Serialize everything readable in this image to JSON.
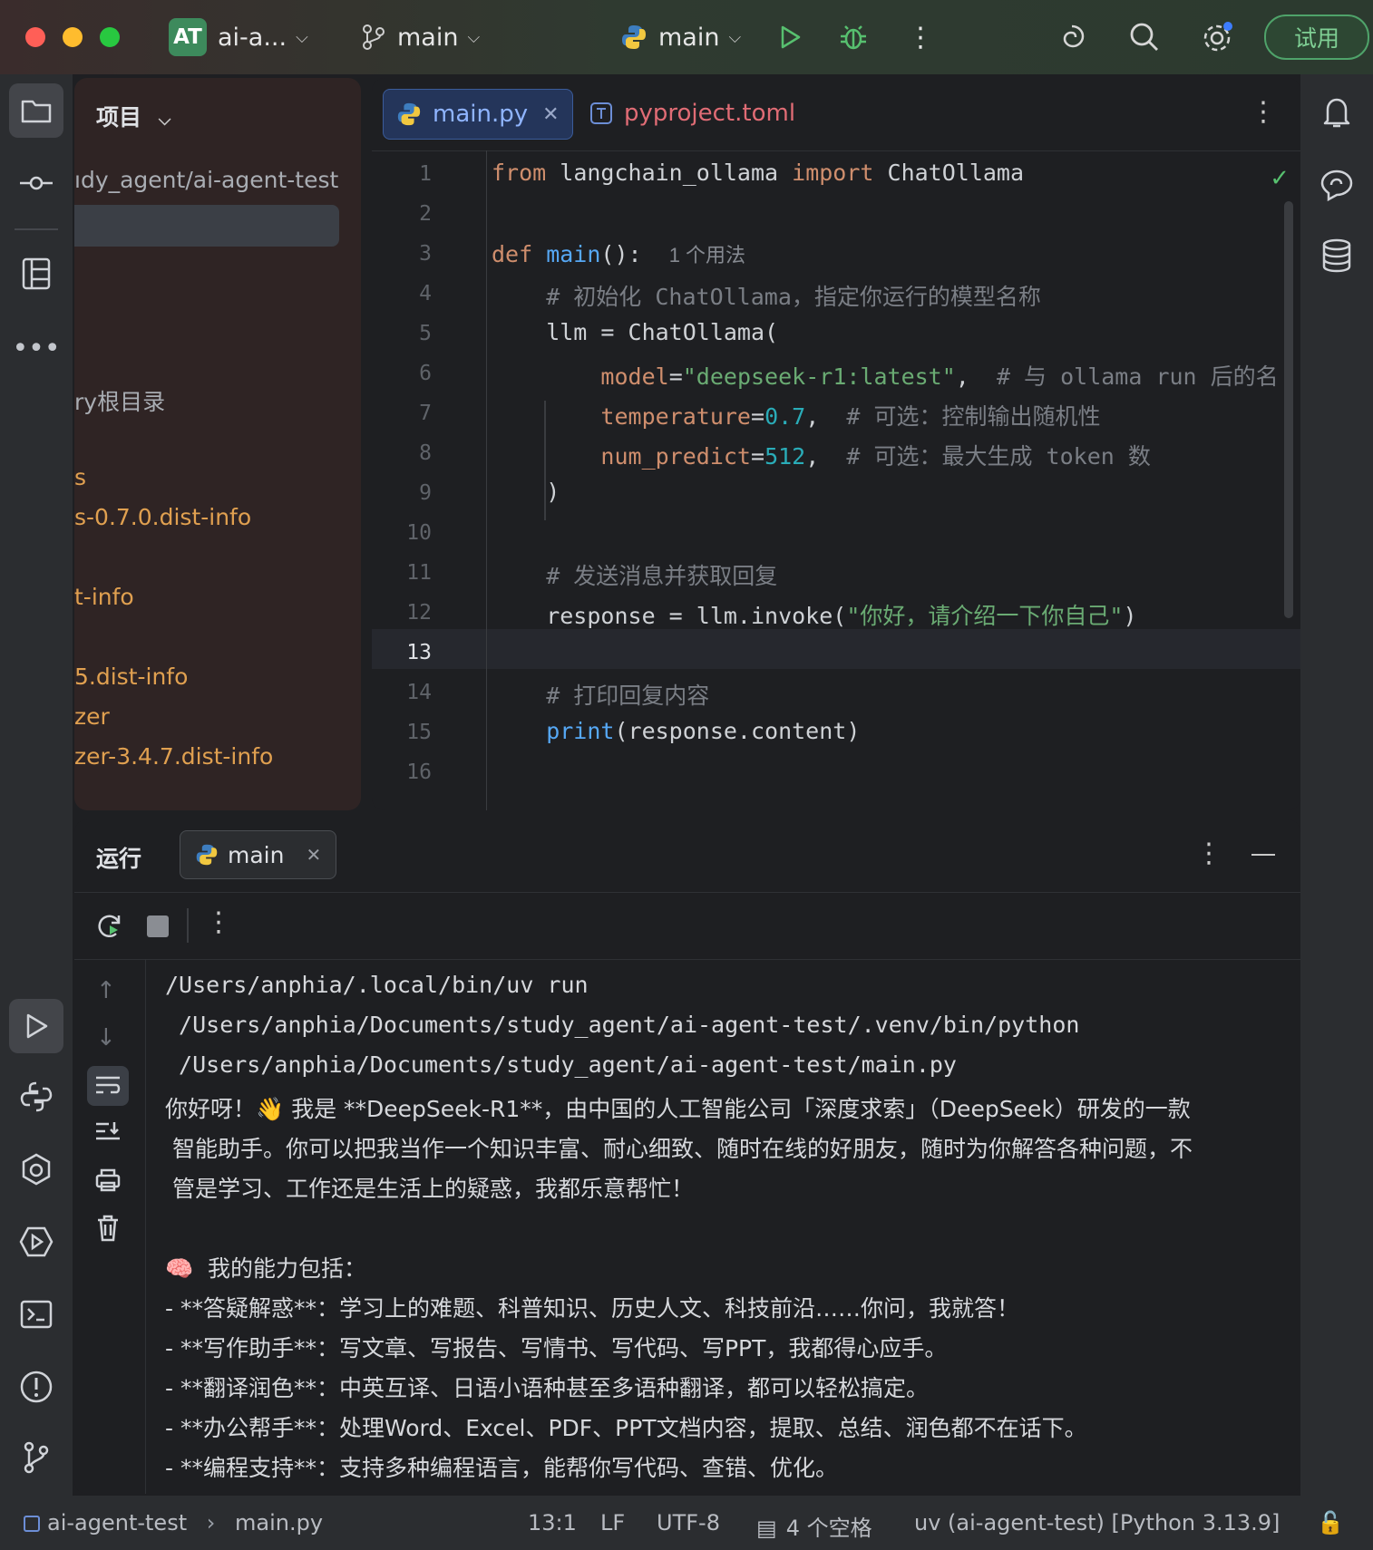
{
  "titlebar": {
    "project_badge": "AT",
    "project_name": "ai-a...",
    "vcs_branch": "main",
    "run_config": "main",
    "trial_label": "试用",
    "colors": {
      "close": "#ff5f57",
      "minimize": "#febc2e",
      "maximize": "#28c840"
    }
  },
  "project_panel": {
    "title": "项目",
    "items": [
      {
        "label": "ıdy_agent/ai-agent-test",
        "color": "#a9adb3"
      },
      {
        "label": "ry根目录",
        "color": "#a9adb3"
      },
      {
        "label": "s",
        "color": "#e0a050"
      },
      {
        "label": "s-0.7.0.dist-info",
        "color": "#e0a050"
      },
      {
        "label": "t-info",
        "color": "#e0a050"
      },
      {
        "label": "5.dist-info",
        "color": "#e0a050"
      },
      {
        "label": "zer",
        "color": "#e0a050"
      },
      {
        "label": "zer-3.4.7.dist-info",
        "color": "#e0a050"
      }
    ]
  },
  "editor": {
    "tabs": [
      {
        "label": "main.py",
        "icon": "python-icon"
      },
      {
        "label": "pyproject.toml",
        "icon": "toml-icon"
      }
    ],
    "line_numbers": [
      "1",
      "2",
      "3",
      "4",
      "5",
      "6",
      "7",
      "8",
      "9",
      "10",
      "11",
      "12",
      "13",
      "14",
      "15",
      "16"
    ],
    "current_line": "13",
    "lines": {
      "l1": {
        "kw1": "from",
        "mod": " langchain_ollama ",
        "kw2": "import",
        "name": " ChatOllama"
      },
      "l3": {
        "kw": "def",
        "fn": " main",
        "rest": "():",
        "hint": "1 个用法"
      },
      "l4": "    # 初始化 ChatOllama，指定你运行的模型名称",
      "l5": "    llm = ChatOllama(",
      "l6": {
        "param": "model",
        "eq": "=",
        "str": "\"deepseek-r1:latest\"",
        "comma": ",",
        "cmt": "  # 与 ollama run 后的名"
      },
      "l7": {
        "param": "temperature",
        "eq": "=",
        "num": "0.7",
        "comma": ",",
        "cmt": "  # 可选：控制输出随机性"
      },
      "l8": {
        "param": "num_predict",
        "eq": "=",
        "num": "512",
        "comma": ",",
        "cmt": "  # 可选：最大生成 token 数"
      },
      "l9": "    )",
      "l11": "    # 发送消息并获取回复",
      "l12": {
        "pre": "    response = llm.invoke(",
        "str": "\"你好，请介绍一下你自己\"",
        "post": ")"
      },
      "l14": "    # 打印回复内容",
      "l15": {
        "fn": "    print",
        "rest": "(response.content)"
      }
    }
  },
  "run_panel": {
    "title": "运行",
    "tab": "main",
    "output": [
      "/Users/anphia/.local/bin/uv run",
      " /Users/anphia/Documents/study_agent/ai-agent-test/.venv/bin/python",
      " /Users/anphia/Documents/study_agent/ai-agent-test/main.py",
      "你好呀！👋 我是 **DeepSeek-R1**，由中国的人工智能公司「深度求索」（DeepSeek）研发的一款",
      " 智能助手。你可以把我当作一个知识丰富、耐心细致、随时在线的好朋友，随时为你解答各种问题，不",
      " 管是学习、工作还是生活上的疑惑，我都乐意帮忙！",
      "",
      "🧠  我的能力包括：",
      "- **答疑解惑**：学习上的难题、科普知识、历史人文、科技前沿……你问，我就答！",
      "- **写作助手**：写文章、写报告、写情书、写代码、写PPT，我都得心应手。",
      "- **翻译润色**：中英互译、日语小语种甚至多语种翻译，都可以轻松搞定。",
      "- **办公帮手**：处理Word、Excel、PDF、PPT文档内容，提取、总结、润色都不在话下。",
      "- **编程支持**：支持多种编程语言，能帮你写代码、查错、优化。"
    ]
  },
  "statusbar": {
    "project": "ai-agent-test",
    "file": "main.py",
    "position": "13:1",
    "line_ending": "LF",
    "encoding": "UTF-8",
    "indent": "4 个空格",
    "interpreter": "uv (ai-agent-test) [Python 3.13.9]"
  }
}
